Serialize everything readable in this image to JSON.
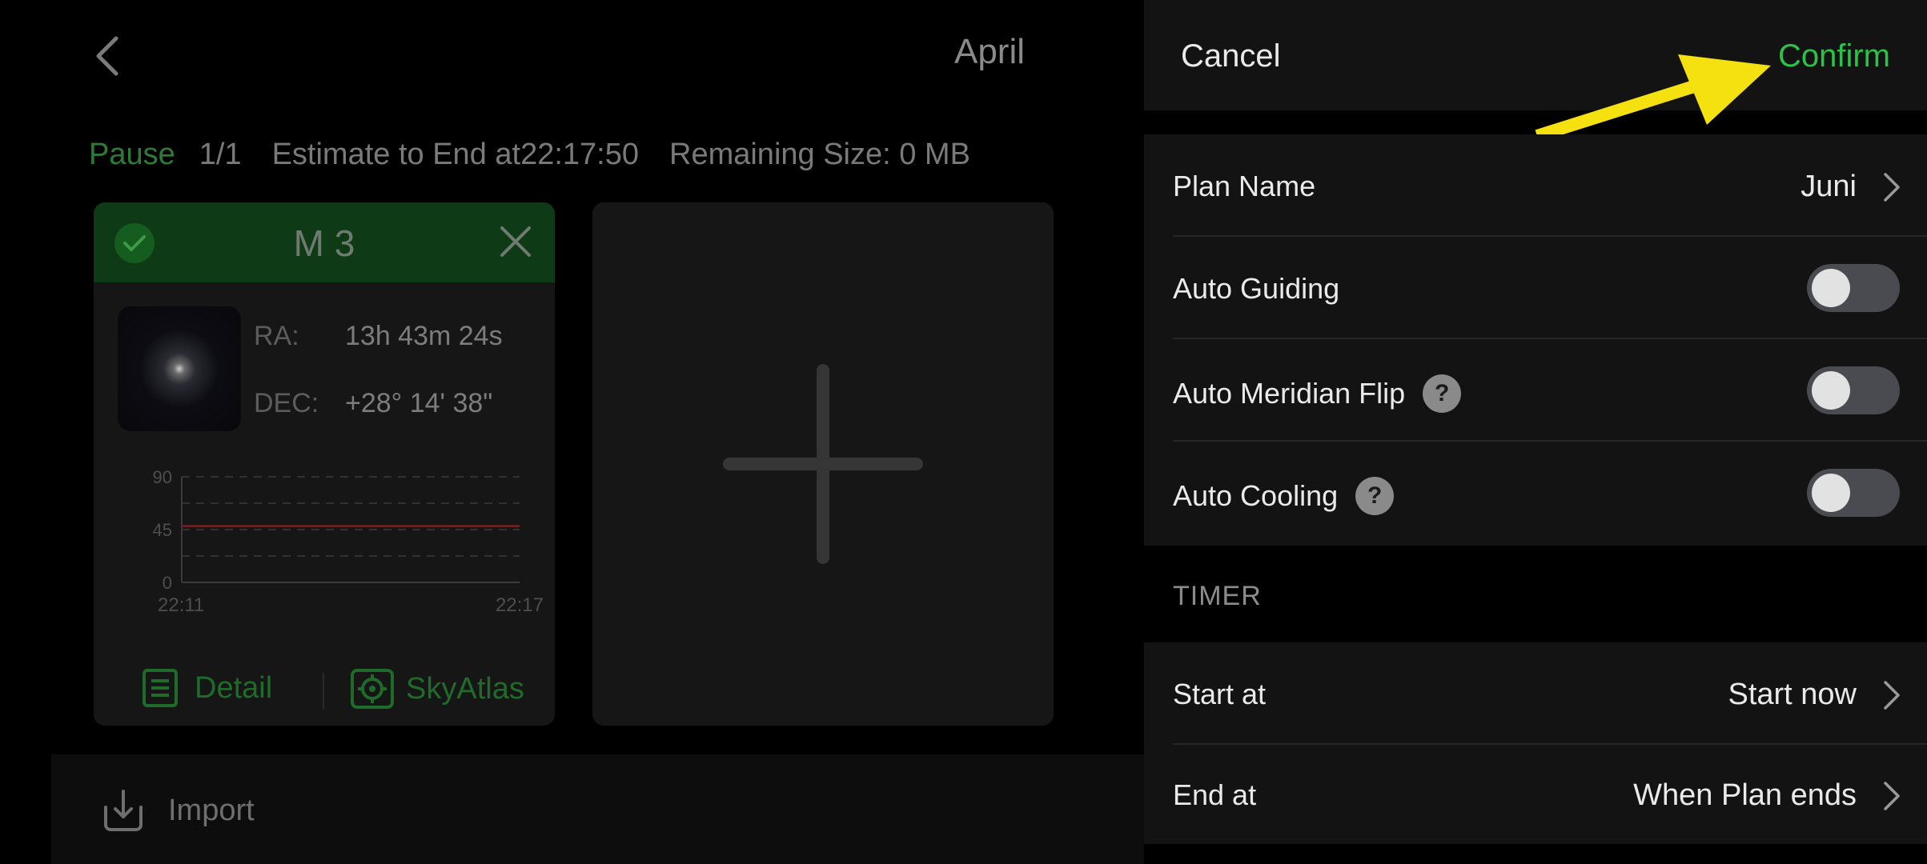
{
  "left": {
    "title": "April",
    "status": {
      "state": "Pause",
      "progress": "1/1",
      "estimate": "Estimate to End at22:17:50",
      "remaining": "Remaining Size: 0 MB"
    },
    "target": {
      "name": "M 3",
      "ra_label": "RA:",
      "ra_value": "13h 43m 24s",
      "dec_label": "DEC:",
      "dec_value": "+28° 14' 38\"",
      "detail_label": "Detail",
      "skyatlas_label": "SkyAtlas"
    },
    "import_label": "Import"
  },
  "chart_data": {
    "type": "line",
    "x_ticks": [
      "22:11",
      "22:17"
    ],
    "y_ticks": [
      "90",
      "45",
      "0"
    ],
    "ylim": [
      0,
      90
    ],
    "grid": true,
    "series": [
      {
        "color": "#7a1f1f",
        "values": [
          48,
          48
        ]
      }
    ]
  },
  "panel": {
    "cancel": "Cancel",
    "confirm": "Confirm",
    "rows": {
      "plan_name_label": "Plan Name",
      "plan_name_value": "Juni",
      "auto_guiding": "Auto Guiding",
      "auto_guiding_on": false,
      "auto_meridian": "Auto Meridian Flip",
      "auto_meridian_on": false,
      "auto_cooling": "Auto Cooling",
      "auto_cooling_on": false
    },
    "timer_title": "TIMER",
    "timer": {
      "start_label": "Start at",
      "start_value": "Start now",
      "end_label": "End at",
      "end_value": "When Plan ends"
    },
    "help_glyph": "?"
  },
  "colors": {
    "accent_green": "#2cc24a",
    "annotation_arrow": "#f5e10f"
  }
}
